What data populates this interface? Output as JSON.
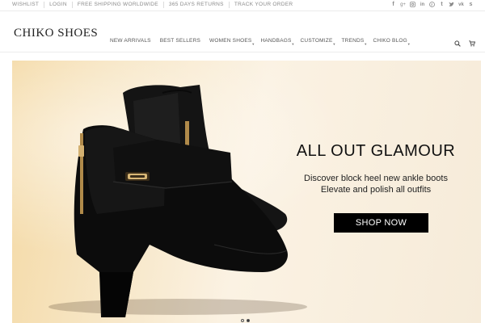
{
  "topbar": {
    "links": [
      "WISHLIST",
      "LOGIN",
      "FREE SHIPPING WORLDWIDE",
      "365 DAYS RETURNS",
      "TRACK YOUR ORDER"
    ],
    "social_icons": [
      "facebook-icon",
      "google-plus-icon",
      "instagram-icon",
      "linkedin-icon",
      "pinterest-icon",
      "tumblr-icon",
      "twitter-icon",
      "vk-icon",
      "skype-icon"
    ]
  },
  "header": {
    "logo": "CHIKO SHOES",
    "nav": [
      {
        "label": "NEW ARRIVALS",
        "has_dropdown": false
      },
      {
        "label": "BEST SELLERS",
        "has_dropdown": false
      },
      {
        "label": "WOMEN SHOES",
        "has_dropdown": true
      },
      {
        "label": "HANDBAGS",
        "has_dropdown": true
      },
      {
        "label": "CUSTOMIZE",
        "has_dropdown": true
      },
      {
        "label": "TRENDS",
        "has_dropdown": true
      },
      {
        "label": "CHIKO BLOG",
        "has_dropdown": true
      }
    ],
    "tools": [
      "search-icon",
      "cart-icon"
    ]
  },
  "hero": {
    "title": "ALL OUT GLAMOUR",
    "subtitle_line1": "Discover block heel new ankle boots",
    "subtitle_line2": "Elevate and polish all outfits",
    "cta": "SHOP NOW",
    "slides": 2,
    "active_slide": 2
  },
  "colors": {
    "accent": "#000000",
    "background": "#ffffff",
    "hero_warm": "#f4d9a4"
  }
}
